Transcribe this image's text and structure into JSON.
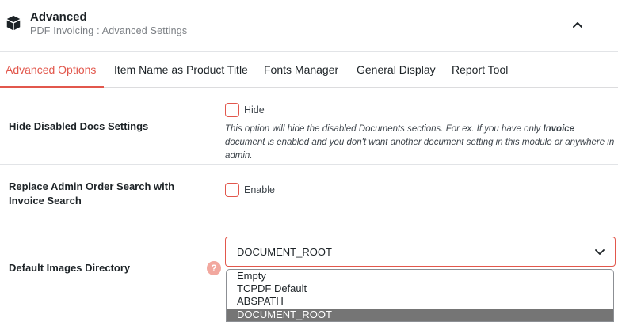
{
  "header": {
    "title": "Advanced",
    "subtitle": "PDF Invoicing : Advanced Settings",
    "icon": "cube-icon",
    "collapse_icon": "chevron-up-icon"
  },
  "tabs": [
    {
      "label": "Advanced Options",
      "active": true
    },
    {
      "label": "Item Name as Product Title",
      "active": false
    },
    {
      "label": "Fonts Manager",
      "active": false
    },
    {
      "label": "General Display",
      "active": false
    },
    {
      "label": "Report Tool",
      "active": false
    }
  ],
  "settings": {
    "hide_disabled": {
      "label": "Hide Disabled Docs Settings",
      "checkbox_label": "Hide",
      "checked": false,
      "description_pre": "This option will hide the disabled Documents sections. For ex. If you have only ",
      "description_bold": "Invoice",
      "description_post": " document is enabled and you don't want another document setting in this module or anywhere in admin."
    },
    "replace_search": {
      "label_line1": "Replace Admin Order Search with",
      "label_line2": "Invoice Search",
      "checkbox_label": "Enable",
      "checked": false
    },
    "images_directory": {
      "label": "Default Images Directory",
      "help": "?",
      "selected": "DOCUMENT_ROOT",
      "options": [
        "Empty",
        "TCPDF Default",
        "ABSPATH",
        "DOCUMENT_ROOT"
      ]
    }
  },
  "colors": {
    "accent": "#e2574c",
    "selected_option_bg": "#757575",
    "help_bg": "#f2a89f"
  }
}
